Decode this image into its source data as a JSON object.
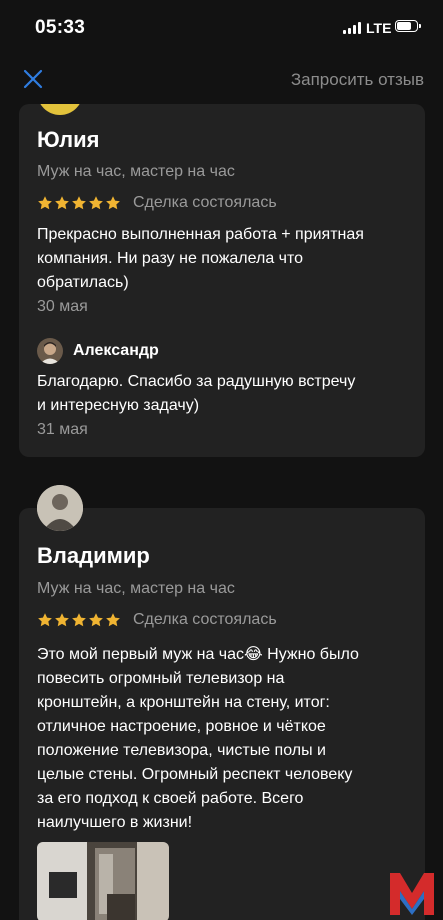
{
  "status_bar": {
    "time": "05:33",
    "network": "LTE",
    "battery_level": 0.85
  },
  "topbar": {
    "close_icon": "close-icon",
    "request_label": "Запросить отзыв"
  },
  "colors": {
    "star": "#f0b432",
    "card": "#222222",
    "background": "#121212",
    "accent_blue": "#2f7de1",
    "logo_red": "#d42b2b"
  },
  "reviews": [
    {
      "name": "Юлия",
      "service": "Муж на час, мастер на час",
      "stars": 5,
      "deal_status": "Сделка состоялась",
      "text_lines": [
        "Прекрасно выполненная работа + приятная",
        "компания. Ни разу не пожалела что",
        "обратилась)"
      ],
      "date": "30 мая",
      "reply": {
        "author": "Александр",
        "text_lines": [
          "Благодарю. Спасибо за радушную встречу",
          "и интересную задачу)"
        ],
        "date": "31 мая"
      }
    },
    {
      "name": "Владимир",
      "service": "Муж на час, мастер на час",
      "stars": 5,
      "deal_status": "Сделка состоялась",
      "text_lines": [
        "Это мой первый муж на час😂 Нужно было",
        "повесить огромный телевизор на",
        "кронштейн, а кронштейн на стену, итог:",
        "отличное настроение, ровное и чёткое",
        "положение телевизора, чистые полы и",
        "целые стены. Огромный респект человеку",
        "за его подход к своей работе. Всего",
        "наилучшего в жизни!"
      ]
    }
  ]
}
